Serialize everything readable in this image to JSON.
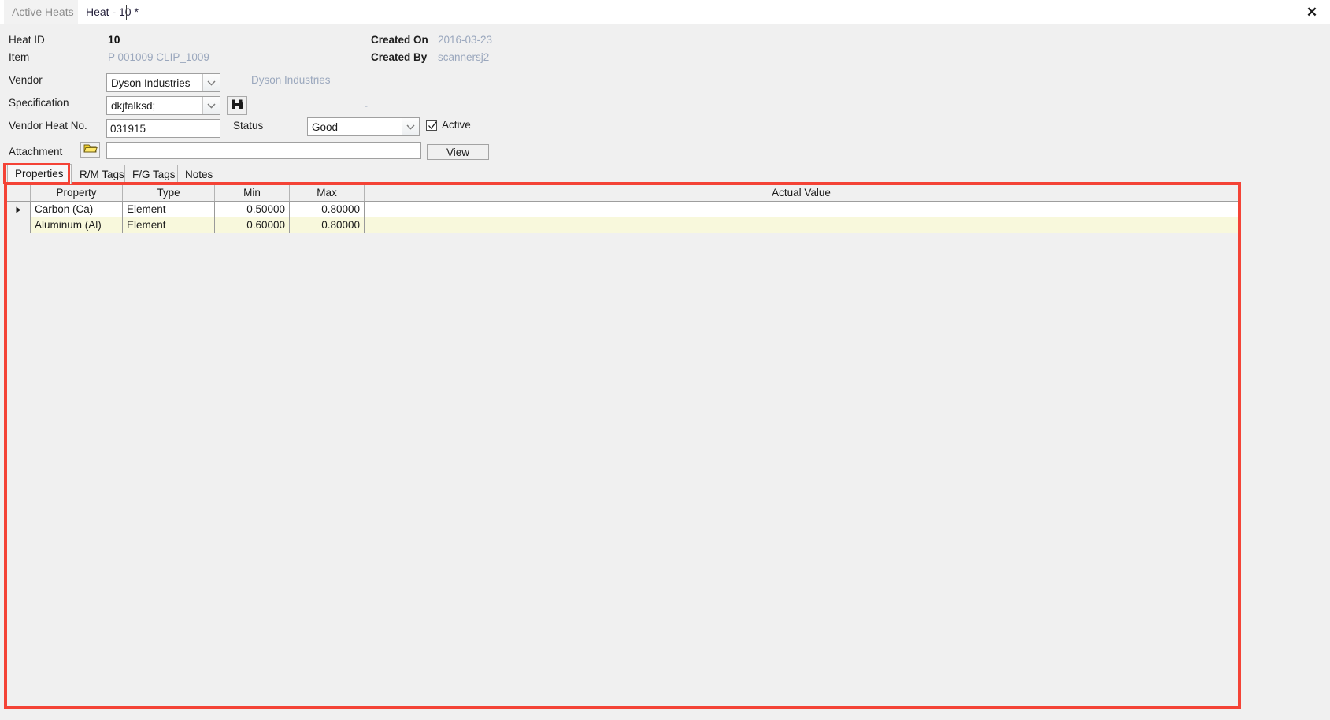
{
  "window": {
    "close_label": "✕"
  },
  "top_tabs": [
    {
      "label": "Active Heats",
      "active": false
    },
    {
      "label": "Heat - 10 *",
      "active": true
    }
  ],
  "form": {
    "heat_id_label": "Heat ID",
    "heat_id_value": "10",
    "item_label": "Item",
    "item_value": "P 001009 CLIP_1009",
    "vendor_label": "Vendor",
    "vendor_value": "Dyson Industries",
    "vendor_display_text": "Dyson Industries",
    "specification_label": "Specification",
    "specification_value": "dkjfalksd;",
    "specification_note": "-",
    "search_icon_name": "binoculars-icon",
    "vendor_heat_no_label": "Vendor Heat No.",
    "vendor_heat_no_value": "031915",
    "status_label": "Status",
    "status_value": "Good",
    "active_label": "Active",
    "active_checked": true,
    "attachment_label": "Attachment",
    "attachment_value": "",
    "attachment_placeholder": "",
    "view_button_label": "View",
    "created_on_label": "Created On",
    "created_on_value": "2016-03-23",
    "created_by_label": "Created By",
    "created_by_value": "scannersj2"
  },
  "inner_tabs": [
    {
      "label": "Properties",
      "selected": true
    },
    {
      "label": "R/M Tags",
      "selected": false
    },
    {
      "label": "F/G Tags",
      "selected": false
    },
    {
      "label": "Notes",
      "selected": false
    }
  ],
  "grid": {
    "columns": [
      "Property",
      "Type",
      "Min",
      "Max",
      "Actual Value"
    ],
    "rows": [
      {
        "selected": true,
        "property": "Carbon (Ca)",
        "type": "Element",
        "min": "0.50000",
        "max": "0.80000",
        "actual_value": ""
      },
      {
        "selected": false,
        "property": "Aluminum (Al)",
        "type": "Element",
        "min": "0.60000",
        "max": "0.80000",
        "actual_value": ""
      }
    ]
  },
  "colors": {
    "highlight_red": "#f44336",
    "row_highlight_yellow": "#f8f8dc",
    "muted_blue": "#9aa7bd",
    "window_bg": "#f0f0f0"
  }
}
